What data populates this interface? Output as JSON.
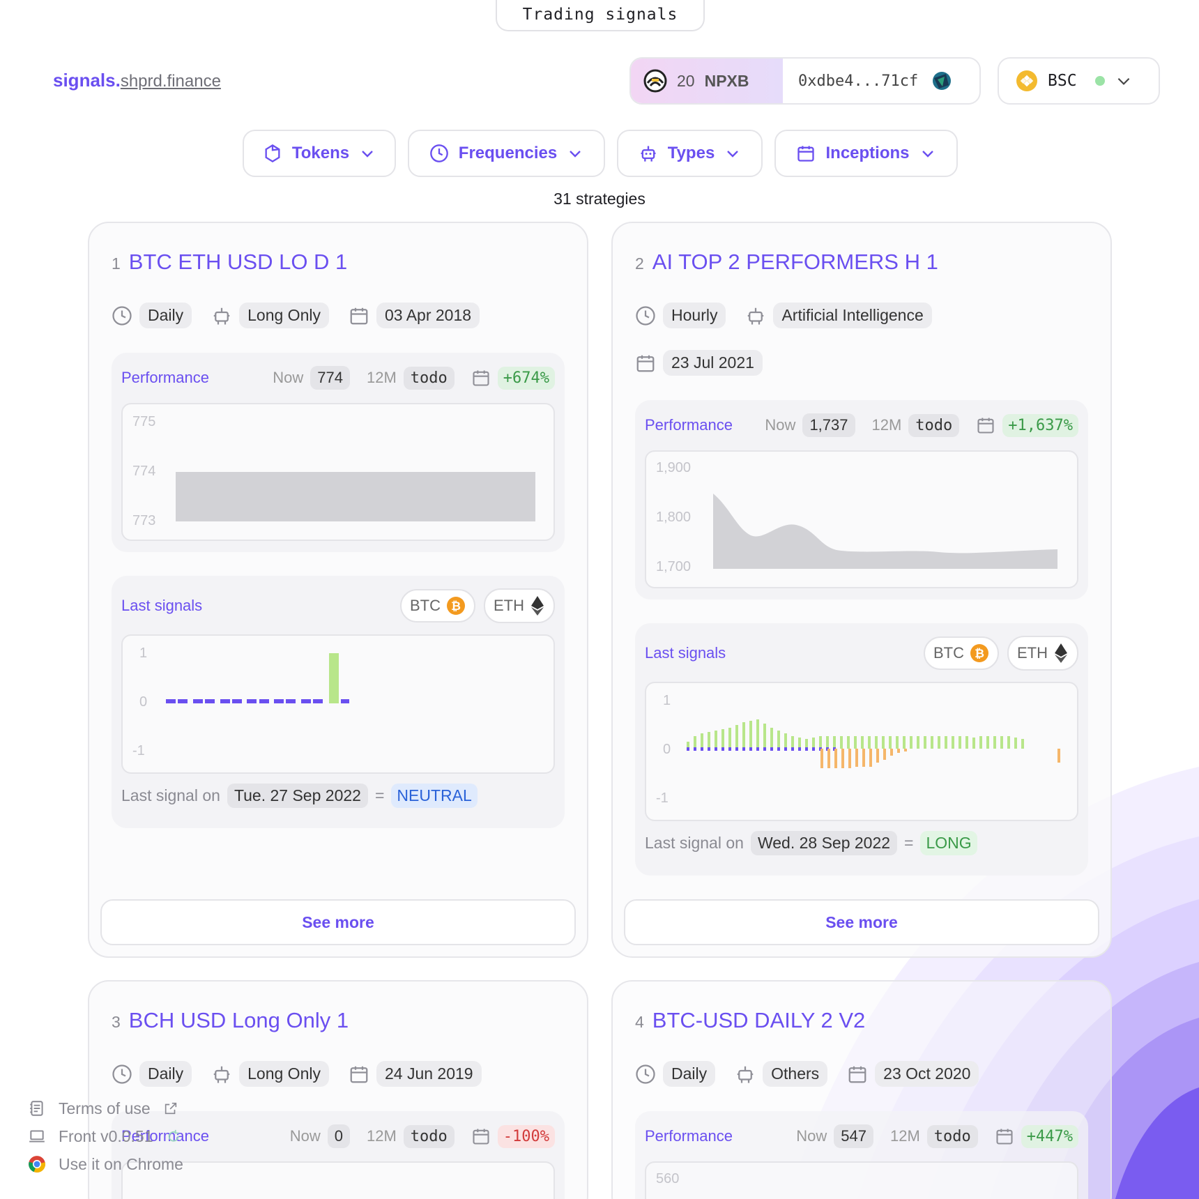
{
  "top_tab": "Trading signals",
  "brand": {
    "primary": "signals.",
    "secondary": "shprd.finance"
  },
  "wallet": {
    "amount": "20",
    "symbol": "NPXB",
    "address": "0xdbe4...71cf"
  },
  "network": {
    "name": "BSC"
  },
  "filters": [
    {
      "label": "Tokens",
      "icon": "hexagon-icon"
    },
    {
      "label": "Frequencies",
      "icon": "clock-icon"
    },
    {
      "label": "Types",
      "icon": "robot-icon"
    },
    {
      "label": "Inceptions",
      "icon": "calendar-icon"
    }
  ],
  "count_label": "31 strategies",
  "labels": {
    "performance": "Performance",
    "now": "Now",
    "twelve_m": "12M",
    "last_signals": "Last signals",
    "last_signal_on": "Last signal on",
    "equals": "=",
    "see_more": "See more"
  },
  "cards": [
    {
      "index": "1",
      "title": "BTC ETH USD LO D 1",
      "frequency": "Daily",
      "type": "Long Only",
      "inception": "03 Apr 2018",
      "now": "774",
      "twelve_m": "todo",
      "since_inception": "+674%",
      "perf_ticks": [
        "775",
        "774",
        "773"
      ],
      "signal_ticks": [
        "1",
        "0",
        "-1"
      ],
      "coins": [
        "BTC",
        "ETH"
      ],
      "last_date": "Tue. 27 Sep 2022",
      "last_state": "NEUTRAL"
    },
    {
      "index": "2",
      "title": "AI TOP 2 PERFORMERS H 1",
      "frequency": "Hourly",
      "type": "Artificial Intelligence",
      "inception": "23 Jul 2021",
      "now": "1,737",
      "twelve_m": "todo",
      "since_inception": "+1,637%",
      "perf_ticks": [
        "1,900",
        "1,800",
        "1,700"
      ],
      "signal_ticks": [
        "1",
        "0",
        "-1"
      ],
      "coins": [
        "BTC",
        "ETH"
      ],
      "last_date": "Wed. 28 Sep 2022",
      "last_state": "LONG"
    },
    {
      "index": "3",
      "title": "BCH USD Long Only 1",
      "frequency": "Daily",
      "type": "Long Only",
      "inception": "24 Jun 2019",
      "now": "0",
      "twelve_m": "todo",
      "since_inception": "-100%"
    },
    {
      "index": "4",
      "title": "BTC-USD DAILY 2 V2",
      "frequency": "Daily",
      "type": "Others",
      "inception": "23 Oct 2020",
      "now": "547",
      "twelve_m": "todo",
      "since_inception": "+447%",
      "perf_ticks": [
        "560"
      ]
    }
  ],
  "footer": [
    {
      "label": "Terms of use",
      "icon": "document-icon"
    },
    {
      "label": "Front v0.0.51",
      "icon": "laptop-icon"
    },
    {
      "label": "Use it on Chrome",
      "icon": "chrome-icon"
    }
  ],
  "colors": {
    "accent": "#6a4ff0",
    "positive": "#3a9a48",
    "negative": "#d23b3b",
    "neutral": "#2a62d8",
    "signal_long": "#b8e68a",
    "signal_short": "#f5b66a",
    "signal_neutral": "#6a4ff0"
  }
}
